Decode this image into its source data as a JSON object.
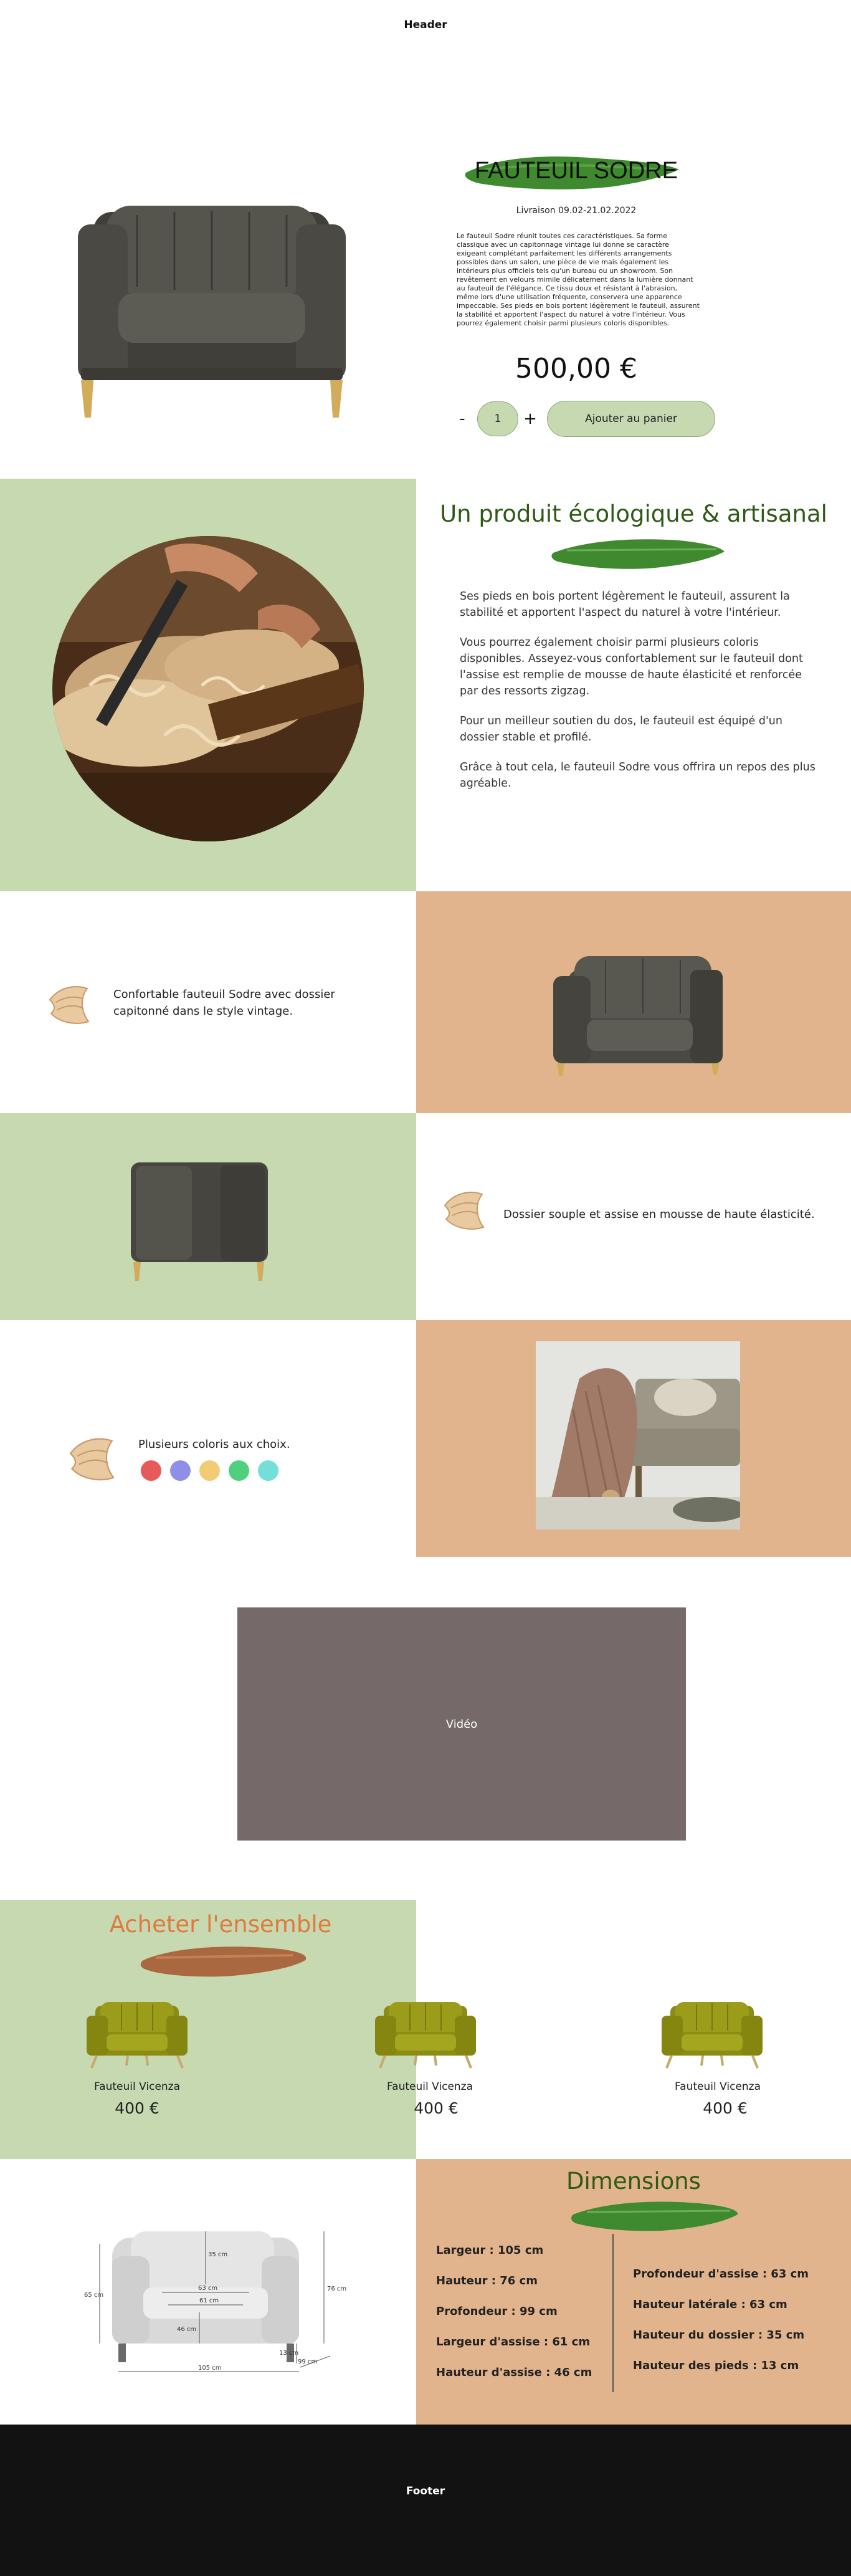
{
  "header": {
    "label": "Header"
  },
  "product": {
    "title": "FAUTEUIL SODRE",
    "delivery": "Livraison 09.02-21.02.2022",
    "description": "Le fauteuil Sodre réunit toutes ces caractéristiques. Sa forme classique avec un capitonnage vintage lui donne se caractère exigeant complétant parfaitement les différents arrangements possibles dans un salon, une pièce de vie mais également les intérieurs plus officiels tels qu'un bureau ou un showroom. Son revêtement en velours mimile délicatement dans la lumière donnant au fauteuil de l'élégance. Ce tissu doux et résistant à l'abrasion, même lors d'une utilisation fréquente, conservera une apparence impeccable. Ses pieds en bois portent légèrement le fauteuil, assurent la stabilité et apportent l'aspect du naturel à votre l'intérieur. Vous pourrez également choisir parmi plusieurs coloris disponibles.",
    "price": "500,00 €",
    "minus": "-",
    "quantity": "1",
    "plus": "+",
    "add_to_cart": "Ajouter au panier"
  },
  "eco": {
    "title": "Un produit écologique & artisanal",
    "paragraphs": [
      "Ses pieds en bois portent légèrement le fauteuil, assurent la stabilité et apportent l'aspect du naturel à votre l'intérieur.",
      "Vous pourrez également choisir parmi plusieurs coloris disponibles. Asseyez-vous confortablement sur le fauteuil dont l'assise est remplie de mousse de haute élasticité et renforcée par des ressorts zigzag.",
      "Pour un meilleur soutien du dos, le fauteuil est équipé d'un dossier stable et profilé.",
      "Grâce à tout cela, le fauteuil Sodre vous offrira un repos des plus agréable."
    ]
  },
  "features": [
    {
      "text": "Confortable fauteuil Sodre avec dossier capitonné dans le style vintage."
    },
    {
      "text": "Dossier souple et assise en mousse de haute élasticité."
    },
    {
      "text": "Plusieurs coloris aux choix."
    }
  ],
  "colors": [
    "#e85a5a",
    "#8f8fe8",
    "#f2cc74",
    "#4ed07f",
    "#74dfd8"
  ],
  "video": {
    "label": "Vidéo"
  },
  "set": {
    "title": "Acheter l'ensemble",
    "items": [
      {
        "name": "Fauteuil Vicenza",
        "price": "400 €"
      },
      {
        "name": "Fauteuil Vicenza",
        "price": "400 €"
      },
      {
        "name": "Fauteuil Vicenza",
        "price": "400 €"
      }
    ]
  },
  "diagram": {
    "h65": "65 cm",
    "w105": "105 cm",
    "w35": "35 cm",
    "w63": "63 cm",
    "w61": "61 cm",
    "w46": "46 cm",
    "h76": "76 cm",
    "h13": "13 cm",
    "d99": "99 cm"
  },
  "dimensions": {
    "title": "Dimensions",
    "left": [
      "Largeur : 105 cm",
      "Hauteur : 76 cm",
      "Profondeur : 99 cm",
      "Largeur d'assise : 61 cm",
      "Hauteur d'assise : 46 cm"
    ],
    "right": [
      "Profondeur d'assise : 63 cm",
      "Hauteur latérale : 63 cm",
      "Hauteur du dossier : 35 cm",
      "Hauteur des pieds : 13 cm"
    ]
  },
  "footer": {
    "label": "Footer"
  },
  "palette": {
    "green": "#c6d9b0",
    "tan": "#e2b48d",
    "brush_green": "#3f8a2e",
    "orange_title": "#e07a3e",
    "dark_green_title": "#2f5a16",
    "video_bg": "#756a69",
    "footer_bg": "#121212"
  }
}
